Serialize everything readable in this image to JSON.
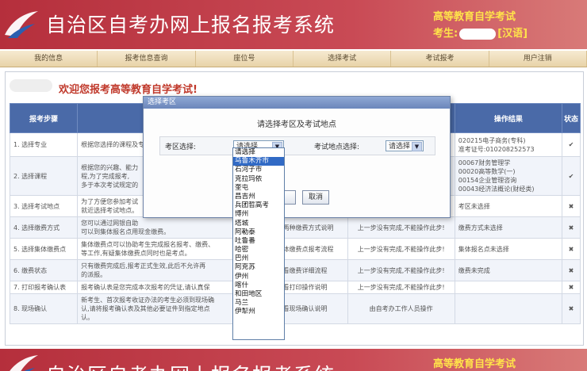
{
  "header": {
    "title": "自治区自考办网上报名报考系统",
    "subtitle": "高等教育自学考试",
    "examinee_label": "考生:",
    "language_tag": "[汉语]"
  },
  "nav": {
    "items": [
      "我的信息",
      "报考信息查询",
      "座位号",
      "选择考试",
      "考试报考",
      "用户注销"
    ]
  },
  "welcome": "欢迎您报考高等教育自学考试!",
  "table": {
    "headers": {
      "step": "报考步骤",
      "result": "操作结果",
      "status": "状态"
    },
    "rows": [
      {
        "step": "1. 选择专业",
        "desc": "根据您选择的课程及专业,为了完成报考时可",
        "action": "",
        "result": "020215电子商务(专科)\n准考证号:010208252573",
        "status": "ok"
      },
      {
        "step": "2. 选择课程",
        "desc": "根据您的兴趣、能力\n程,为了完成报考,\n多于本次考试规定的",
        "action": "",
        "result": "00067财务管理学\n00020高等数学(一)\n00154企业管理咨询\n00043经济法概论(财经类)",
        "status": "ok"
      },
      {
        "step": "3. 选择考试地点",
        "desc": "为了方便您参加考试\n就近选择考试地点。",
        "action": "",
        "result": "考区未选择",
        "status": "no"
      },
      {
        "step": "4. 选择缴费方式",
        "desc": "您可以通过网银自助\n可以到集体报名点用现金缴费。",
        "action": "查看两种缴费方式说明",
        "notice": "上一步没有完成,不能操作此步!",
        "result": "缴费方式未选择",
        "status": "no"
      },
      {
        "step": "5. 选择集体缴费点",
        "desc": "集体缴费点可以协助考生完成报名报考、缴费、\n等工作,有疑集体缴费点同时也是考点。",
        "action": "看集体缴费点报考流程",
        "notice": "上一步没有完成,不能操作此步!",
        "result": "集体报名点未选择",
        "status": "no"
      },
      {
        "step": "6. 缴费状态",
        "desc": "只有缴费完成后,报考正式生效,此后不允许再\n的派报。",
        "action": "查看缴费详细流程",
        "notice": "上一步没有完成,不能操作此步!",
        "result": "缴费未完成",
        "status": "no"
      },
      {
        "step": "7. 打印报考确认表",
        "desc": "报考确认表是您完成本次报考的凭证,请认真保",
        "action": "查看打印操作说明",
        "notice": "上一步没有完成,不能操作此步!",
        "result": "",
        "status": "no"
      },
      {
        "step": "8. 现场确认",
        "desc": "新考生、首次报考收证办法的考生必须到现场确\n认,请将报考确认表及其他必要证件到指定地点\n认。",
        "action": "查看现场确认说明",
        "notice": "由自考办工作人员操作",
        "result": "",
        "status": "no"
      }
    ]
  },
  "dialog": {
    "title": "选择考区",
    "heading": "请选择考区及考试地点",
    "region_label": "考区选择:",
    "region_value": "请选择",
    "site_label": "考试地点选择:",
    "site_value": "请选择",
    "confirm_label": "",
    "cancel_label": "取消"
  },
  "dropdown": {
    "options": [
      "请选择",
      "乌鲁木齐市",
      "石河子市",
      "克拉玛依",
      "奎屯",
      "昌吉州",
      "兵团哲高考",
      "博州",
      "塔城",
      "阿勒泰",
      "吐鲁番",
      "哈密",
      "巴州",
      "阿克苏",
      "伊州",
      "喀什",
      "和田地区",
      "马兰",
      "伊犁州"
    ],
    "highlighted": 1
  },
  "colors": {
    "brand": "#b52f3c",
    "accent": "#ffe34a",
    "header_blue": "#4a6aa8"
  }
}
